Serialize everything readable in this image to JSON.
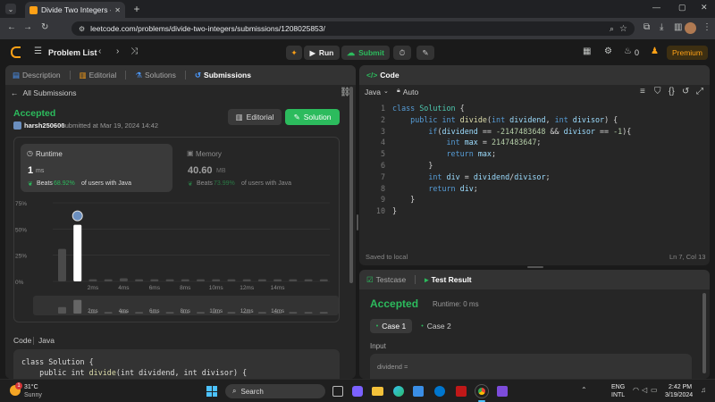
{
  "browser": {
    "tab_title": "Divide Two Integers - LeetCode",
    "url": "leetcode.com/problems/divide-two-integers/submissions/1208025853/",
    "new_tab_glyph": "+"
  },
  "header": {
    "problem_list": "Problem List",
    "run": "Run",
    "submit": "Submit",
    "streak": "0",
    "premium": "Premium"
  },
  "left_tabs": {
    "description": "Description",
    "editorial": "Editorial",
    "solutions": "Solutions",
    "submissions": "Submissions"
  },
  "submission": {
    "back_label": "All Submissions",
    "status": "Accepted",
    "user": "harsh250600",
    "submitted_at": "submitted at Mar 19, 2024 14:42",
    "editorial_btn": "Editorial",
    "solution_btn": "Solution",
    "runtime_label": "Runtime",
    "runtime_value": "1",
    "runtime_unit": "ms",
    "runtime_beats_prefix": "Beats",
    "runtime_beats": "68.92%",
    "runtime_beats_suffix": "of users with Java",
    "memory_label": "Memory",
    "memory_value": "40.60",
    "memory_unit": "MB",
    "memory_beats_prefix": "Beats",
    "memory_beats": "73.99%",
    "memory_beats_suffix": "of users with Java",
    "code_label": "Code",
    "code_lang": "Java"
  },
  "chart_data": {
    "type": "bar",
    "y_ticks": [
      "75%",
      "50%",
      "25%",
      "0%"
    ],
    "ylim": [
      0,
      75
    ],
    "x_ticks": [
      "2ms",
      "4ms",
      "6ms",
      "8ms",
      "10ms",
      "12ms",
      "14ms"
    ],
    "values": [
      31,
      54,
      2,
      2,
      3,
      2,
      2,
      2,
      2,
      2,
      2,
      2,
      2,
      2,
      2,
      2,
      2,
      2
    ],
    "highlight_index": 1,
    "mini_values": [
      8,
      17,
      2,
      2,
      3,
      2,
      2,
      2,
      2,
      2,
      2,
      2,
      2,
      2,
      2,
      2,
      2,
      2
    ]
  },
  "code_panel": {
    "title": "Code",
    "language": "Java",
    "mode": "Auto",
    "saved": "Saved to local",
    "cursor": "Ln 7, Col 13"
  },
  "code_lines": [
    [
      "class ",
      "Solution",
      " {"
    ],
    [
      "    public int ",
      "divide",
      "(int dividend, int divisor) {"
    ],
    [
      "        if(dividend == ",
      "-2147483648",
      " && divisor == ",
      "-1",
      "){"
    ],
    [
      "            int max = ",
      "2147483647",
      ";"
    ],
    [
      "            return max;"
    ],
    [
      "        }"
    ],
    [
      "        int div = dividend/divisor;"
    ],
    [
      "        return div;"
    ],
    [
      "    }"
    ],
    [
      "}"
    ]
  ],
  "snippet": {
    "line1": "class Solution {",
    "line2_a": "    public int ",
    "line2_fn": "divide",
    "line2_b": "(int dividend, int divisor) {"
  },
  "result_panel": {
    "testcase_tab": "Testcase",
    "result_tab": "Test Result",
    "status": "Accepted",
    "runtime": "Runtime: 0 ms",
    "case1": "Case 1",
    "case2": "Case 2",
    "input_label": "Input",
    "input_field": "dividend ="
  },
  "taskbar": {
    "temp": "31°C",
    "weather": "Sunny",
    "search": "Search",
    "lang1": "ENG",
    "lang2": "INTL",
    "time": "2:42 PM",
    "date": "3/19/2024",
    "notif": "1"
  }
}
